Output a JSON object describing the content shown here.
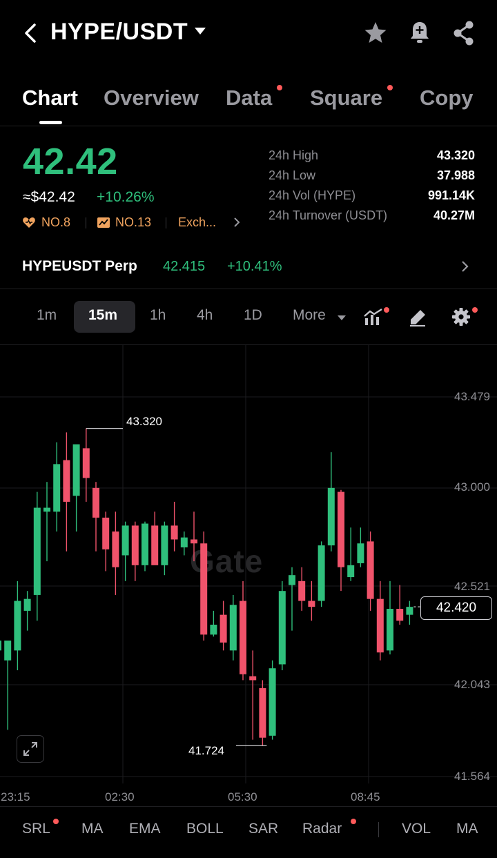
{
  "header": {
    "pair": "HYPE/USDT"
  },
  "tabs": [
    {
      "label": "Chart",
      "dot": false
    },
    {
      "label": "Overview",
      "dot": false
    },
    {
      "label": "Data",
      "dot": true
    },
    {
      "label": "Square",
      "dot": true
    },
    {
      "label": "Copy",
      "dot": false
    }
  ],
  "ticker": {
    "price": "42.42",
    "usd_price": "≈$42.42",
    "change": "+10.26%",
    "rank1": "NO.8",
    "rank2": "NO.13",
    "exchange": "Exch..."
  },
  "stats": [
    {
      "label": "24h High",
      "value": "43.320"
    },
    {
      "label": "24h Low",
      "value": "37.988"
    },
    {
      "label": "24h Vol (HYPE)",
      "value": "991.14K"
    },
    {
      "label": "24h Turnover (USDT)",
      "value": "40.27M"
    }
  ],
  "perp": {
    "name": "HYPEUSDT Perp",
    "price": "42.415",
    "change": "+10.41%"
  },
  "intervals": {
    "items": [
      "1m",
      "15m",
      "1h",
      "4h",
      "1D"
    ],
    "active": "15m",
    "more": "More"
  },
  "colors": {
    "up": "#2fbf7c",
    "down": "#f0536b",
    "accent_dot": "#ff5a5a"
  },
  "watermark": "Gate",
  "chart_data": {
    "type": "candlestick",
    "y_ticks": [
      "43.479",
      "43.000",
      "42.521",
      "42.043",
      "41.564"
    ],
    "ylim": [
      41.564,
      43.479
    ],
    "x_ticks": [
      "23:15",
      "02:30",
      "05:30",
      "08:45"
    ],
    "high_label": "43.320",
    "low_label": "41.724",
    "last_price": "42.420",
    "candles": [
      {
        "o": 42.2,
        "h": 42.4,
        "l": 42.05,
        "c": 42.25
      },
      {
        "o": 42.15,
        "h": 42.25,
        "l": 41.8,
        "c": 42.25
      },
      {
        "o": 42.2,
        "h": 42.55,
        "l": 42.1,
        "c": 42.45
      },
      {
        "o": 42.4,
        "h": 42.5,
        "l": 42.3,
        "c": 42.46
      },
      {
        "o": 42.48,
        "h": 43.0,
        "l": 42.35,
        "c": 42.92
      },
      {
        "o": 42.9,
        "h": 43.05,
        "l": 42.65,
        "c": 42.92
      },
      {
        "o": 42.9,
        "h": 43.25,
        "l": 42.8,
        "c": 43.14
      },
      {
        "o": 43.16,
        "h": 43.3,
        "l": 42.7,
        "c": 42.95
      },
      {
        "o": 42.98,
        "h": 43.2,
        "l": 42.8,
        "c": 43.24
      },
      {
        "o": 43.22,
        "h": 43.32,
        "l": 42.95,
        "c": 43.07
      },
      {
        "o": 43.02,
        "h": 43.05,
        "l": 42.7,
        "c": 42.87
      },
      {
        "o": 42.87,
        "h": 42.9,
        "l": 42.6,
        "c": 42.71
      },
      {
        "o": 42.8,
        "h": 42.9,
        "l": 42.48,
        "c": 42.62
      },
      {
        "o": 42.68,
        "h": 42.85,
        "l": 42.55,
        "c": 42.83
      },
      {
        "o": 42.83,
        "h": 42.85,
        "l": 42.55,
        "c": 42.63
      },
      {
        "o": 42.63,
        "h": 42.85,
        "l": 42.6,
        "c": 42.84
      },
      {
        "o": 42.83,
        "h": 42.9,
        "l": 42.65,
        "c": 42.63
      },
      {
        "o": 42.63,
        "h": 42.85,
        "l": 42.58,
        "c": 42.83
      },
      {
        "o": 42.83,
        "h": 42.95,
        "l": 42.7,
        "c": 42.76
      },
      {
        "o": 42.72,
        "h": 42.8,
        "l": 42.68,
        "c": 42.77
      },
      {
        "o": 42.76,
        "h": 42.9,
        "l": 42.65,
        "c": 42.74
      },
      {
        "o": 42.74,
        "h": 42.8,
        "l": 42.25,
        "c": 42.28
      },
      {
        "o": 42.28,
        "h": 42.4,
        "l": 42.27,
        "c": 42.33
      },
      {
        "o": 42.38,
        "h": 42.45,
        "l": 42.2,
        "c": 42.24
      },
      {
        "o": 42.2,
        "h": 42.48,
        "l": 42.15,
        "c": 42.43
      },
      {
        "o": 42.45,
        "h": 42.55,
        "l": 42.05,
        "c": 42.08
      },
      {
        "o": 42.07,
        "h": 42.2,
        "l": 41.75,
        "c": 42.05
      },
      {
        "o": 42.01,
        "h": 42.05,
        "l": 41.72,
        "c": 41.76
      },
      {
        "o": 41.77,
        "h": 42.15,
        "l": 41.75,
        "c": 42.11
      },
      {
        "o": 42.13,
        "h": 42.55,
        "l": 42.1,
        "c": 42.5
      },
      {
        "o": 42.53,
        "h": 42.62,
        "l": 42.3,
        "c": 42.58
      },
      {
        "o": 42.55,
        "h": 42.62,
        "l": 42.4,
        "c": 42.45
      },
      {
        "o": 42.45,
        "h": 42.55,
        "l": 42.35,
        "c": 42.42
      },
      {
        "o": 42.45,
        "h": 42.75,
        "l": 42.42,
        "c": 42.73
      },
      {
        "o": 42.73,
        "h": 43.2,
        "l": 42.7,
        "c": 43.02
      },
      {
        "o": 43.0,
        "h": 43.01,
        "l": 42.5,
        "c": 42.62
      },
      {
        "o": 42.57,
        "h": 42.82,
        "l": 42.55,
        "c": 42.63
      },
      {
        "o": 42.64,
        "h": 42.82,
        "l": 42.62,
        "c": 42.74
      },
      {
        "o": 42.75,
        "h": 42.8,
        "l": 42.4,
        "c": 42.46
      },
      {
        "o": 42.46,
        "h": 42.55,
        "l": 42.15,
        "c": 42.19
      },
      {
        "o": 42.2,
        "h": 42.55,
        "l": 42.18,
        "c": 42.41
      },
      {
        "o": 42.41,
        "h": 42.53,
        "l": 42.33,
        "c": 42.35
      },
      {
        "o": 42.38,
        "h": 42.45,
        "l": 42.33,
        "c": 42.42
      }
    ]
  },
  "indicators": [
    "SRL",
    "MA",
    "EMA",
    "BOLL",
    "SAR",
    "Radar",
    "VOL",
    "MA"
  ]
}
